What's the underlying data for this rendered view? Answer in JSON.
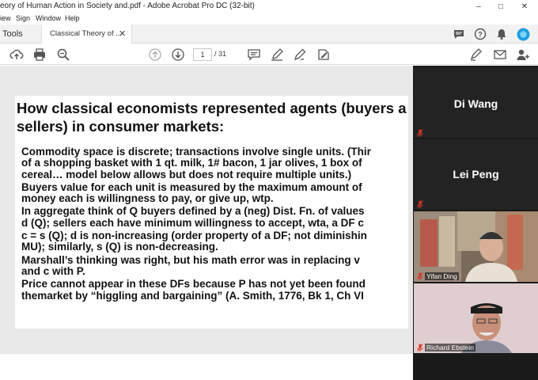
{
  "window": {
    "title": "eory of Human Action in Society and.pdf - Adobe Acrobat Pro DC (32-bit)",
    "controls": [
      "–",
      "□",
      "✕"
    ]
  },
  "menu": [
    "iew",
    "Sign",
    "Window",
    "Help"
  ],
  "tabs": {
    "tools_label": "Tools",
    "document_tab_label": "Classical Theory of ...",
    "close_glyph": "✕"
  },
  "toolbar": {
    "current_page": "1",
    "total_pages": "/ 31"
  },
  "slide": {
    "title_lines": [
      "How classical economists represented agents (buyers a",
      "sellers) in consumer markets:"
    ],
    "bullets": [
      [
        "Commodity space is discrete; transactions involve single units. (Thir",
        "of a shopping basket with 1 qt. milk, 1# bacon, 1 jar olives, 1 box of",
        "cereal… model below allows but does not require multiple units.)"
      ],
      [
        "Buyers value for each unit is measured by the maximum amount of",
        "money each is willingness to pay, or give up, wtp."
      ],
      [
        "In aggregate think of Q buyers defined by a (neg) Dist. Fn. of values",
        "d (Q); sellers each have minimum willingness to accept, wta, a DF c"
      ],
      [
        "c = s (Q); d is non-increasing (order property of a DF; not diminishin",
        "MU); similarly, s (Q) is non-decreasing."
      ],
      [
        "Marshall’s thinking was right, but his math error was in replacing v",
        "and c with P."
      ],
      [
        "Price cannot appear in these DFs because P has not yet been found",
        "themarket by “higgling and bargaining” (A. Smith, 1776, Bk 1, Ch VI"
      ]
    ]
  },
  "participants": [
    {
      "name": "Di Wang",
      "video": false
    },
    {
      "name": "Lei Peng",
      "video": false
    },
    {
      "name": "Yifan Ding",
      "video": true
    },
    {
      "name": "Richard Ebstein",
      "video": true
    }
  ],
  "colors": {
    "accent_blue": "#1a73e8",
    "mic_muted_red": "#d9342b",
    "panel_bg": "#1a1a1a",
    "tile_bg": "#232323"
  }
}
